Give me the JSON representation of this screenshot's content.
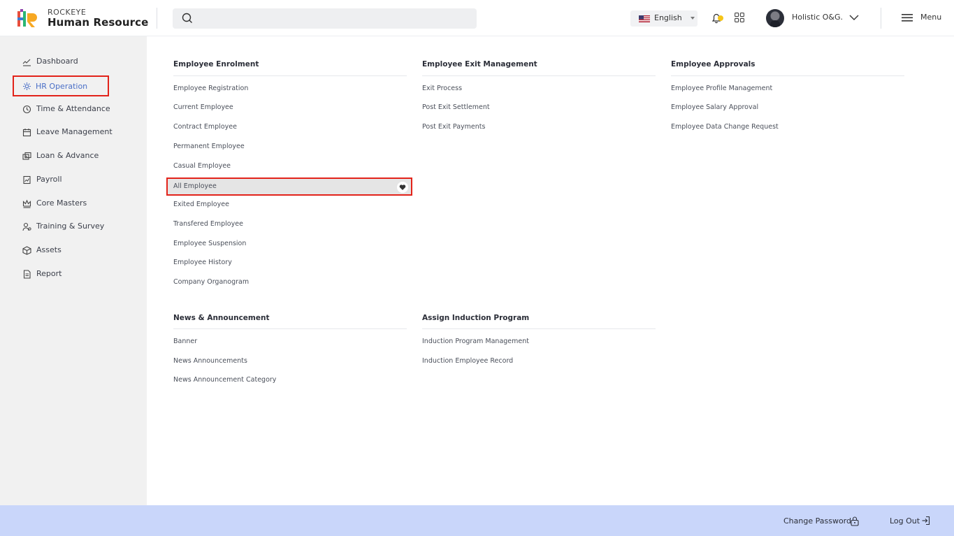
{
  "header": {
    "brand_small": "ROCKEYE",
    "brand_big": "Human Resource",
    "search": {
      "placeholder": ""
    },
    "language": "English",
    "user_name": "Holistic O&G.",
    "menu_label": "Menu",
    "notification_badge_color": "#f5c518"
  },
  "sidebar": {
    "items": [
      {
        "label": "Dashboard",
        "icon": "dashboard-icon"
      },
      {
        "label": "HR Operation",
        "icon": "hr-operation-icon",
        "active": true
      },
      {
        "label": "Time & Attendance",
        "icon": "clock-icon"
      },
      {
        "label": "Leave Management",
        "icon": "calendar-icon"
      },
      {
        "label": "Loan & Advance",
        "icon": "money-icon"
      },
      {
        "label": "Payroll",
        "icon": "payroll-icon"
      },
      {
        "label": "Core Masters",
        "icon": "crown-icon"
      },
      {
        "label": "Training & Survey",
        "icon": "training-icon"
      },
      {
        "label": "Assets",
        "icon": "box-icon"
      },
      {
        "label": "Report",
        "icon": "report-icon"
      }
    ]
  },
  "menu": {
    "enrolment": {
      "title": "Employee Enrolment",
      "links": [
        "Employee Registration",
        "Current Employee",
        "Contract Employee",
        "Permanent Employee",
        "Casual Employee",
        "All Employee",
        "Exited Employee",
        "Transfered Employee",
        "Employee Suspension",
        "Employee History",
        "Company Organogram"
      ]
    },
    "exit": {
      "title": "Employee Exit Management",
      "links": [
        "Exit Process",
        "Post Exit Settlement",
        "Post Exit Payments"
      ]
    },
    "approvals": {
      "title": "Employee Approvals",
      "links": [
        "Employee Profile Management",
        "Employee Salary Approval",
        "Employee Data Change Request"
      ]
    },
    "news": {
      "title": "News & Announcement",
      "links": [
        "Banner",
        "News Announcements",
        "News Announcement Category"
      ]
    },
    "induction": {
      "title": "Assign Induction Program",
      "links": [
        "Induction Program Management",
        "Induction Employee Record"
      ]
    }
  },
  "footer": {
    "change_password": "Change Password",
    "logout": "Log Out"
  },
  "colors": {
    "accent": "#4a6fc7",
    "highlight_border": "#e2231a",
    "footer_bg": "#c9d6fa",
    "sidebar_bg": "#f1f1f1"
  }
}
